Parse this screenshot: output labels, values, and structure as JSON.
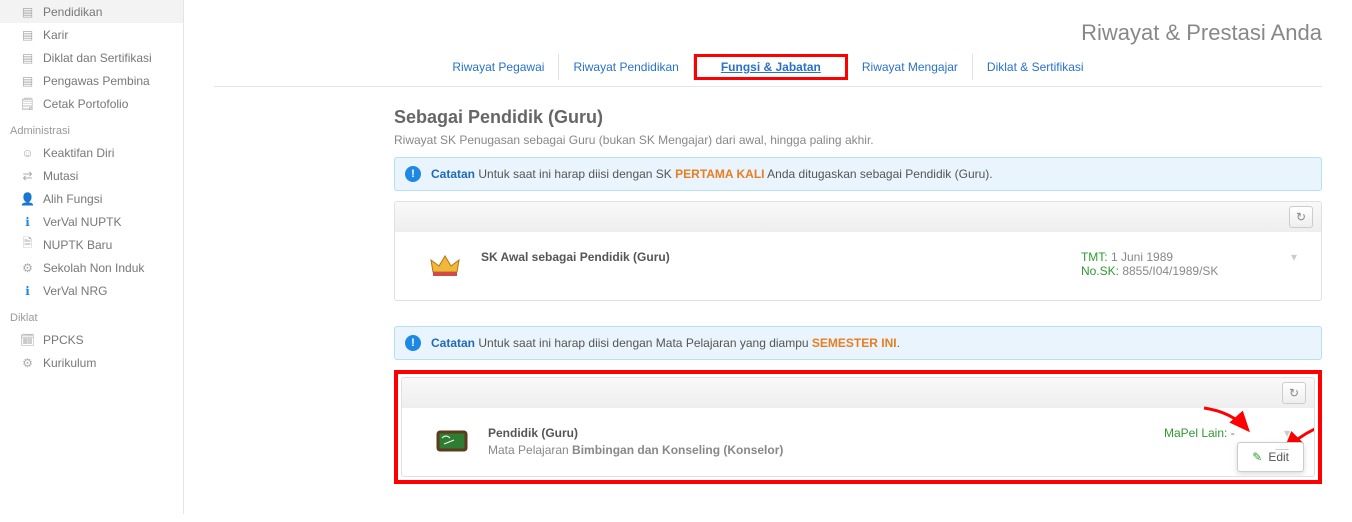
{
  "sidebar": {
    "groups": [
      {
        "items": [
          {
            "icon": "doc",
            "label": "Pendidikan"
          },
          {
            "icon": "doc",
            "label": "Karir"
          },
          {
            "icon": "doc",
            "label": "Diklat dan Sertifikasi"
          },
          {
            "icon": "doc",
            "label": "Pengawas Pembina"
          },
          {
            "icon": "clip",
            "label": "Cetak Portofolio"
          }
        ]
      },
      {
        "header": "Administrasi",
        "items": [
          {
            "icon": "face",
            "label": "Keaktifan Diri"
          },
          {
            "icon": "swap",
            "label": "Mutasi"
          },
          {
            "icon": "person",
            "label": "Alih Fungsi"
          },
          {
            "icon": "info",
            "label": "VerVal NUPTK",
            "blue": true
          },
          {
            "icon": "page",
            "label": "NUPTK Baru"
          },
          {
            "icon": "gear",
            "label": "Sekolah Non Induk"
          },
          {
            "icon": "info",
            "label": "VerVal NRG",
            "blue": true
          }
        ]
      },
      {
        "header": "Diklat",
        "items": [
          {
            "icon": "cal",
            "label": "PPCKS"
          },
          {
            "icon": "gear",
            "label": "Kurikulum"
          }
        ]
      }
    ]
  },
  "page": {
    "title": "Riwayat & Prestasi Anda"
  },
  "tabs": [
    {
      "label": "Riwayat Pegawai"
    },
    {
      "label": "Riwayat Pendidikan"
    },
    {
      "label": "Fungsi & Jabatan",
      "active": true,
      "highlight": true
    },
    {
      "label": "Riwayat Mengajar"
    },
    {
      "label": "Diklat & Sertifikasi"
    }
  ],
  "section": {
    "title": "Sebagai Pendidik (Guru)",
    "subtitle": "Riwayat SK Penugasan sebagai Guru (bukan SK Mengajar) dari awal, hingga paling akhir."
  },
  "note1": {
    "label": "Catatan",
    "pre": "Untuk saat ini harap diisi dengan SK ",
    "em": "PERTAMA KALI",
    "post": " Anda ditugaskan sebagai Pendidik (Guru)."
  },
  "sk": {
    "title": "SK Awal sebagai Pendidik (Guru)",
    "tmt_label": "TMT:",
    "tmt_value": "1 Juni 1989",
    "nosk_label": "No.SK:",
    "nosk_value": "8855/I04/1989/SK"
  },
  "note2": {
    "label": "Catatan",
    "pre": "Untuk saat ini harap diisi dengan Mata Pelajaran yang diampu ",
    "em": "SEMESTER INI",
    "post": "."
  },
  "role": {
    "title": "Pendidik (Guru)",
    "subject_pre": "Mata Pelajaran ",
    "subject": "Bimbingan dan Konseling (Konselor)",
    "mapel_label": "MaPel Lain:",
    "mapel_value": "-"
  },
  "popover": {
    "edit": "Edit"
  }
}
